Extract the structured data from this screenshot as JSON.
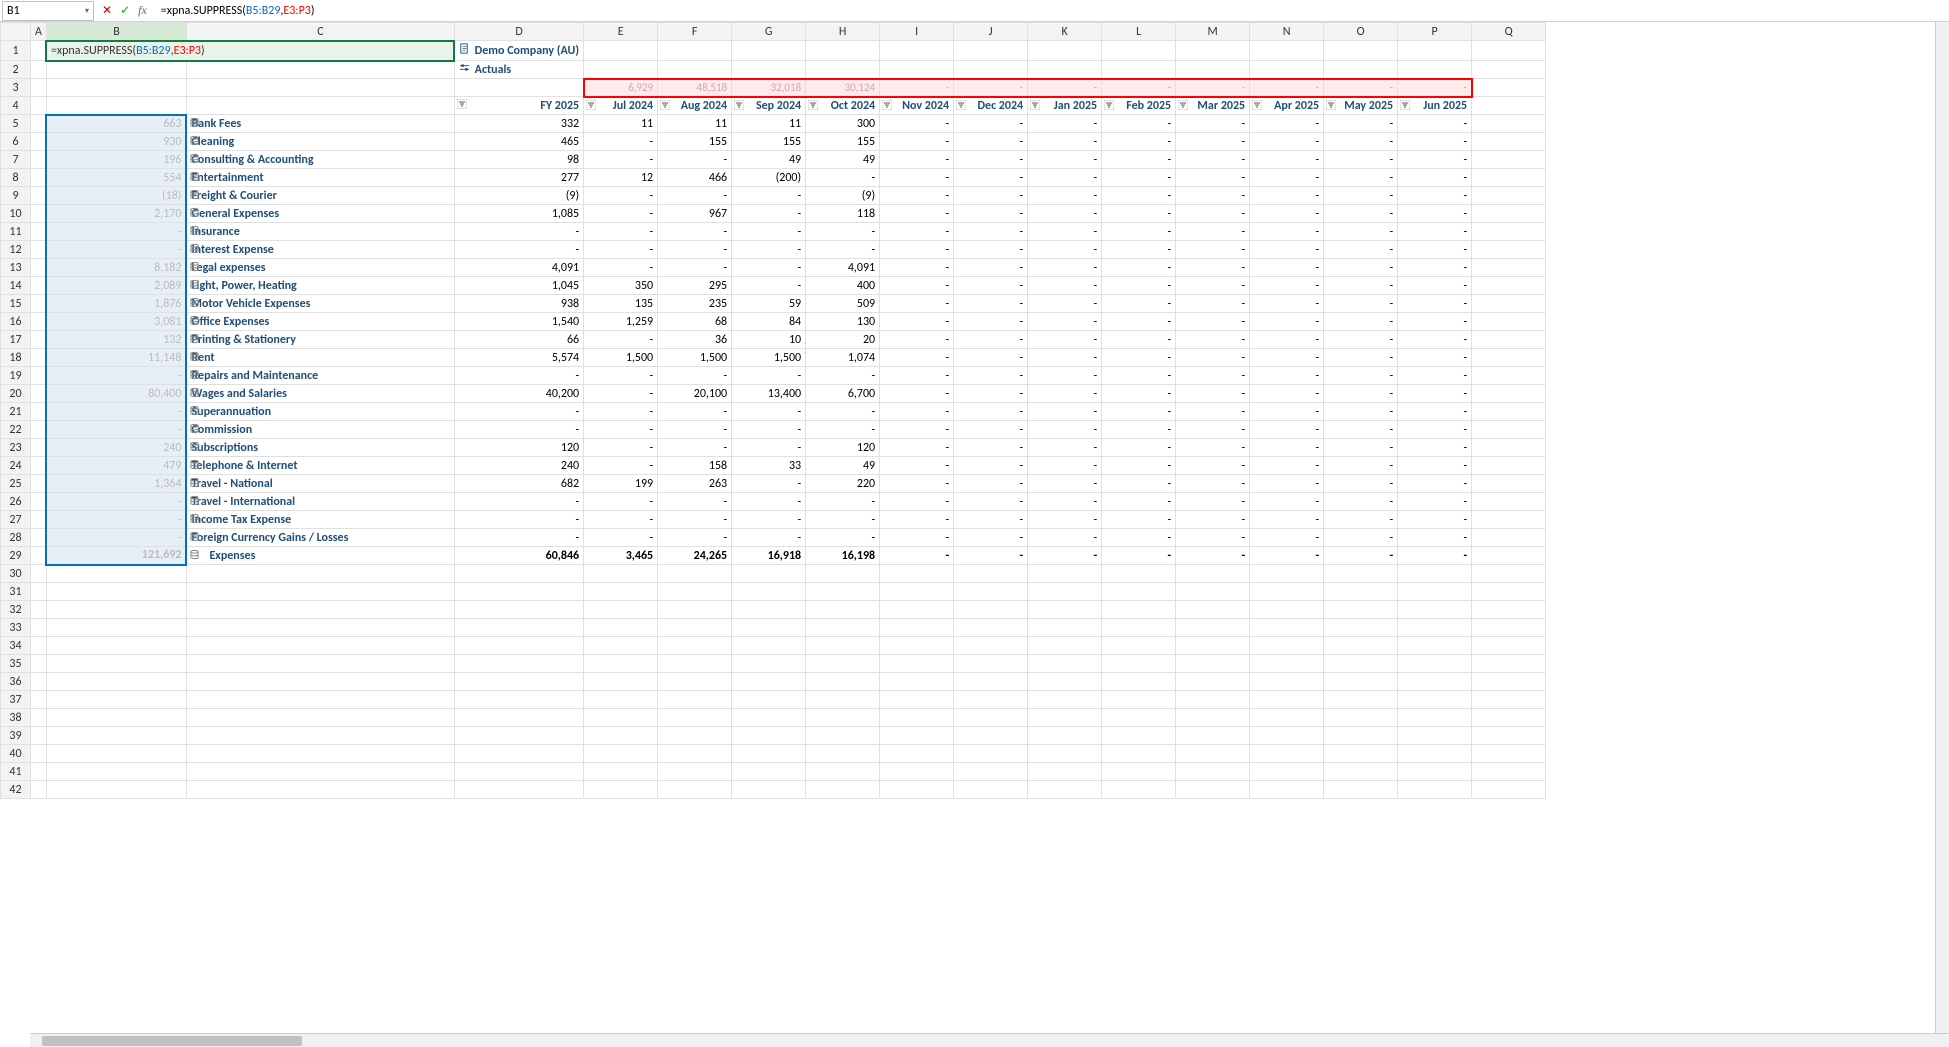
{
  "nameBox": "B1",
  "formula": {
    "prefix": "=xpna.SUPPRESS(",
    "ref1": "B5:B29",
    "sep": ",",
    "ref2": "E3:P3",
    "suffix": ")"
  },
  "meta": {
    "company": "Demo Company (AU)",
    "scenario": "Actuals"
  },
  "row3": [
    "6,929",
    "48,518",
    "32,018",
    "30,124",
    "-",
    "-",
    "-",
    "-",
    "-",
    "-",
    "-",
    "-"
  ],
  "periods": [
    "FY 2025",
    "Jul 2024",
    "Aug 2024",
    "Sep 2024",
    "Oct 2024",
    "Nov 2024",
    "Dec 2024",
    "Jan 2025",
    "Feb 2025",
    "Mar 2025",
    "Apr 2025",
    "May 2025",
    "Jun 2025"
  ],
  "colB": [
    "663",
    "930",
    "196",
    "554",
    "(18)",
    "2,170",
    "-",
    "-",
    "8,182",
    "2,089",
    "1,876",
    "3,081",
    "132",
    "11,148",
    "-",
    "80,400",
    "-",
    "-",
    "240",
    "479",
    "1,364",
    "-",
    "-",
    "-",
    "121,692"
  ],
  "accounts": [
    {
      "name": "Bank Fees",
      "vals": [
        "332",
        "11",
        "11",
        "11",
        "300",
        "-",
        "-",
        "-",
        "-",
        "-",
        "-",
        "-",
        "-"
      ]
    },
    {
      "name": "Cleaning",
      "vals": [
        "465",
        "-",
        "155",
        "155",
        "155",
        "-",
        "-",
        "-",
        "-",
        "-",
        "-",
        "-",
        "-"
      ]
    },
    {
      "name": "Consulting & Accounting",
      "vals": [
        "98",
        "-",
        "-",
        "49",
        "49",
        "-",
        "-",
        "-",
        "-",
        "-",
        "-",
        "-",
        "-"
      ]
    },
    {
      "name": "Entertainment",
      "vals": [
        "277",
        "12",
        "466",
        "(200)",
        "-",
        "-",
        "-",
        "-",
        "-",
        "-",
        "-",
        "-",
        "-"
      ]
    },
    {
      "name": "Freight & Courier",
      "vals": [
        "(9)",
        "-",
        "-",
        "-",
        "(9)",
        "-",
        "-",
        "-",
        "-",
        "-",
        "-",
        "-",
        "-"
      ]
    },
    {
      "name": "General Expenses",
      "vals": [
        "1,085",
        "-",
        "967",
        "-",
        "118",
        "-",
        "-",
        "-",
        "-",
        "-",
        "-",
        "-",
        "-"
      ]
    },
    {
      "name": "Insurance",
      "vals": [
        "-",
        "-",
        "-",
        "-",
        "-",
        "-",
        "-",
        "-",
        "-",
        "-",
        "-",
        "-",
        "-"
      ]
    },
    {
      "name": "Interest Expense",
      "vals": [
        "-",
        "-",
        "-",
        "-",
        "-",
        "-",
        "-",
        "-",
        "-",
        "-",
        "-",
        "-",
        "-"
      ]
    },
    {
      "name": "Legal expenses",
      "vals": [
        "4,091",
        "-",
        "-",
        "-",
        "4,091",
        "-",
        "-",
        "-",
        "-",
        "-",
        "-",
        "-",
        "-"
      ]
    },
    {
      "name": "Light, Power, Heating",
      "vals": [
        "1,045",
        "350",
        "295",
        "-",
        "400",
        "-",
        "-",
        "-",
        "-",
        "-",
        "-",
        "-",
        "-"
      ]
    },
    {
      "name": "Motor Vehicle Expenses",
      "vals": [
        "938",
        "135",
        "235",
        "59",
        "509",
        "-",
        "-",
        "-",
        "-",
        "-",
        "-",
        "-",
        "-"
      ]
    },
    {
      "name": "Office Expenses",
      "vals": [
        "1,540",
        "1,259",
        "68",
        "84",
        "130",
        "-",
        "-",
        "-",
        "-",
        "-",
        "-",
        "-",
        "-"
      ]
    },
    {
      "name": "Printing & Stationery",
      "vals": [
        "66",
        "-",
        "36",
        "10",
        "20",
        "-",
        "-",
        "-",
        "-",
        "-",
        "-",
        "-",
        "-"
      ]
    },
    {
      "name": "Rent",
      "vals": [
        "5,574",
        "1,500",
        "1,500",
        "1,500",
        "1,074",
        "-",
        "-",
        "-",
        "-",
        "-",
        "-",
        "-",
        "-"
      ]
    },
    {
      "name": "Repairs and Maintenance",
      "vals": [
        "-",
        "-",
        "-",
        "-",
        "-",
        "-",
        "-",
        "-",
        "-",
        "-",
        "-",
        "-",
        "-"
      ]
    },
    {
      "name": "Wages and Salaries",
      "vals": [
        "40,200",
        "-",
        "20,100",
        "13,400",
        "6,700",
        "-",
        "-",
        "-",
        "-",
        "-",
        "-",
        "-",
        "-"
      ]
    },
    {
      "name": "Superannuation",
      "vals": [
        "-",
        "-",
        "-",
        "-",
        "-",
        "-",
        "-",
        "-",
        "-",
        "-",
        "-",
        "-",
        "-"
      ]
    },
    {
      "name": "Commission",
      "vals": [
        "-",
        "-",
        "-",
        "-",
        "-",
        "-",
        "-",
        "-",
        "-",
        "-",
        "-",
        "-",
        "-"
      ]
    },
    {
      "name": "Subscriptions",
      "vals": [
        "120",
        "-",
        "-",
        "-",
        "120",
        "-",
        "-",
        "-",
        "-",
        "-",
        "-",
        "-",
        "-"
      ]
    },
    {
      "name": "Telephone & Internet",
      "vals": [
        "240",
        "-",
        "158",
        "33",
        "49",
        "-",
        "-",
        "-",
        "-",
        "-",
        "-",
        "-",
        "-"
      ]
    },
    {
      "name": "Travel - National",
      "vals": [
        "682",
        "199",
        "263",
        "-",
        "220",
        "-",
        "-",
        "-",
        "-",
        "-",
        "-",
        "-",
        "-"
      ]
    },
    {
      "name": "Travel - International",
      "vals": [
        "-",
        "-",
        "-",
        "-",
        "-",
        "-",
        "-",
        "-",
        "-",
        "-",
        "-",
        "-",
        "-"
      ]
    },
    {
      "name": "Income Tax Expense",
      "vals": [
        "-",
        "-",
        "-",
        "-",
        "-",
        "-",
        "-",
        "-",
        "-",
        "-",
        "-",
        "-",
        "-"
      ]
    },
    {
      "name": "Foreign Currency Gains / Losses",
      "vals": [
        "-",
        "-",
        "-",
        "-",
        "-",
        "-",
        "-",
        "-",
        "-",
        "-",
        "-",
        "-",
        "-"
      ]
    }
  ],
  "totalRow": {
    "name": "Expenses",
    "vals": [
      "60,846",
      "3,465",
      "24,265",
      "16,918",
      "16,198",
      "-",
      "-",
      "-",
      "-",
      "-",
      "-",
      "-",
      "-"
    ]
  },
  "colLetters": [
    "A",
    "B",
    "C",
    "D",
    "E",
    "F",
    "G",
    "H",
    "I",
    "J",
    "K",
    "L",
    "M",
    "N",
    "O",
    "P",
    "Q"
  ]
}
